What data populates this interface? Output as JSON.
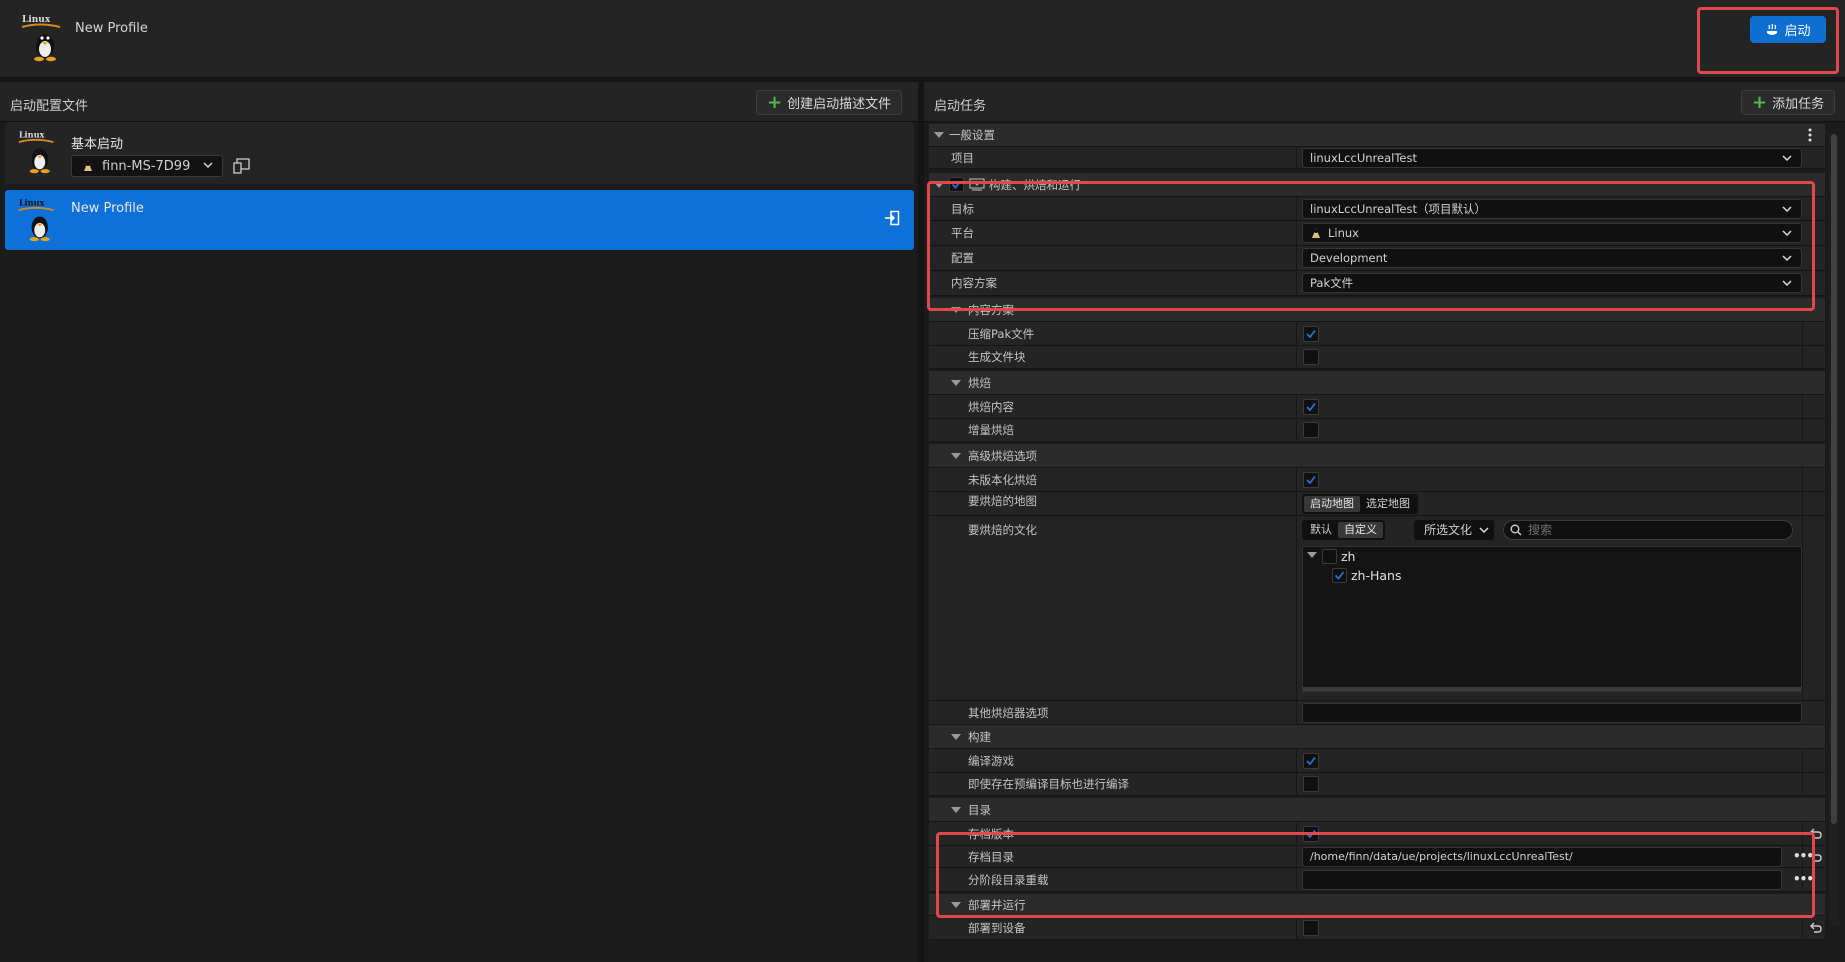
{
  "app": {
    "profile_title": "New Profile",
    "launch_label": "启动",
    "accent": "#0e70d9"
  },
  "left_panel": {
    "title": "启动配置文件",
    "create_button": "创建启动描述文件",
    "logo_text": "Linux",
    "profiles": [
      {
        "name": "基本启动",
        "device": "finn-MS-7D99",
        "selected": false
      },
      {
        "name": "New Profile",
        "selected": true
      }
    ]
  },
  "right_panel": {
    "title": "启动任务",
    "add_button": "添加任务",
    "general": {
      "category": "一般设置",
      "project_label": "项目",
      "project_value": "linuxLccUnrealTest"
    },
    "bcr": {
      "category": "构建、烘焙和运行",
      "enabled": true,
      "target_label": "目标",
      "target_value": "linuxLccUnrealTest（项目默认）",
      "platform_label": "平台",
      "platform_value": "Linux",
      "config_label": "配置",
      "config_value": "Development",
      "content_label": "内容方案",
      "content_value": "Pak文件"
    },
    "content_scheme": {
      "category": "内容方案",
      "compress_label": "压缩Pak文件",
      "compress": true,
      "chunks_label": "生成文件块",
      "chunks": false
    },
    "cook": {
      "category": "烘焙",
      "content_label": "烘焙内容",
      "content": true,
      "incremental_label": "增量烘焙",
      "incremental": false
    },
    "adv_cook": {
      "category": "高级烘焙选项",
      "unversioned_label": "未版本化烘焙",
      "unversioned": true,
      "maps_label": "要烘焙的地图",
      "maps_options": [
        "启动地图",
        "选定地图"
      ],
      "culture_label": "要烘焙的文化",
      "culture_modes": [
        "默认",
        "自定义"
      ],
      "culture_filter": "所选文化",
      "search_placeholder": "搜索",
      "tree": [
        {
          "name": "zh",
          "checked": false
        },
        {
          "name": "zh-Hans",
          "checked": true
        }
      ],
      "other_label": "其他烘焙器选项",
      "other_value": ""
    },
    "build": {
      "category": "构建",
      "compile_label": "编译游戏",
      "compile": true,
      "force_label": "即使存在预编译目标也进行编译",
      "force": false
    },
    "dirs": {
      "category": "目录",
      "archive_label": "存档版本",
      "archive": true,
      "archive_dir_label": "存档目录",
      "archive_dir_value": "/home/finn/data/ue/projects/linuxLccUnrealTest/",
      "staging_label": "分阶段目录重载",
      "staging_value": ""
    },
    "deploy": {
      "category": "部署并运行",
      "to_device_label": "部署到设备",
      "to_device": false
    }
  }
}
